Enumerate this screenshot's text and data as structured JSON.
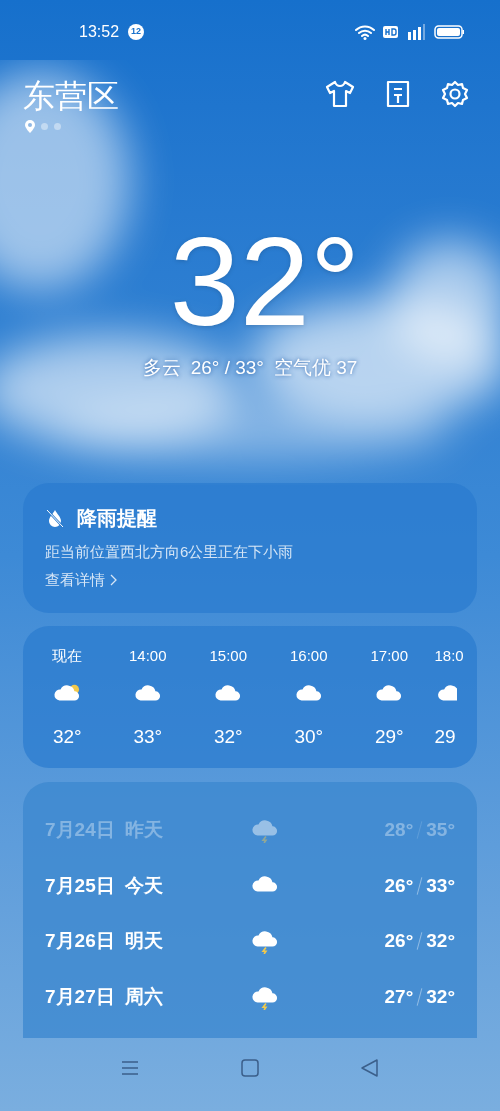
{
  "status_bar": {
    "time": "13:52",
    "notification_count": "12"
  },
  "header": {
    "city": "东营区",
    "pages": [
      {
        "kind": "location",
        "selected": true
      },
      {
        "kind": "dot",
        "selected": false
      },
      {
        "kind": "dot",
        "selected": false
      }
    ]
  },
  "current": {
    "temperature": "32°",
    "condition": "多云",
    "range": "26° / 33°",
    "air_quality": "空气优 37"
  },
  "rain_alert": {
    "title": "降雨提醒",
    "message": "距当前位置西北方向6公里正在下小雨",
    "link": "查看详情"
  },
  "hourly": [
    {
      "time": "现在",
      "kind": "partly_cloudy",
      "temp": "32°"
    },
    {
      "time": "14:00",
      "kind": "cloudy",
      "temp": "33°"
    },
    {
      "time": "15:00",
      "kind": "cloudy",
      "temp": "32°"
    },
    {
      "time": "16:00",
      "kind": "cloudy",
      "temp": "30°"
    },
    {
      "time": "17:00",
      "kind": "cloudy",
      "temp": "29°"
    },
    {
      "time": "18:0",
      "kind": "cloudy",
      "temp": "29"
    }
  ],
  "daily": [
    {
      "date": "7月24日",
      "day": "昨天",
      "kind": "thunder",
      "low": "28°",
      "high": "35°",
      "past": true
    },
    {
      "date": "7月25日",
      "day": "今天",
      "kind": "cloudy",
      "low": "26°",
      "high": "33°",
      "past": false
    },
    {
      "date": "7月26日",
      "day": "明天",
      "kind": "thunder",
      "low": "26°",
      "high": "32°",
      "past": false
    },
    {
      "date": "7月27日",
      "day": "周六",
      "kind": "thunder",
      "low": "27°",
      "high": "32°",
      "past": false
    }
  ]
}
